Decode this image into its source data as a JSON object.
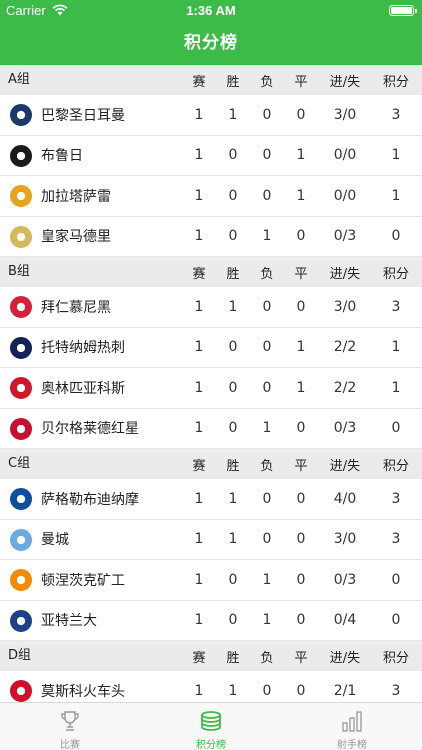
{
  "status": {
    "carrier": "Carrier",
    "time": "1:36 AM"
  },
  "header": {
    "title": "积分榜"
  },
  "columns": {
    "played": "赛",
    "won": "胜",
    "lost": "负",
    "drawn": "平",
    "goals": "进/失",
    "points": "积分"
  },
  "groups": [
    {
      "name": "A组",
      "teams": [
        {
          "name": "巴黎圣日耳曼",
          "p": "1",
          "w": "1",
          "l": "0",
          "d": "0",
          "g": "3/0",
          "pts": "3",
          "crest": "psg-crest",
          "color": "#1b3a6b"
        },
        {
          "name": "布鲁日",
          "p": "1",
          "w": "0",
          "l": "0",
          "d": "1",
          "g": "0/0",
          "pts": "1",
          "crest": "club-brugge-crest",
          "color": "#1a1a1a"
        },
        {
          "name": "加拉塔萨雷",
          "p": "1",
          "w": "0",
          "l": "0",
          "d": "1",
          "g": "0/0",
          "pts": "1",
          "crest": "galatasaray-crest",
          "color": "#e8a21b"
        },
        {
          "name": "皇家马德里",
          "p": "1",
          "w": "0",
          "l": "1",
          "d": "0",
          "g": "0/3",
          "pts": "0",
          "crest": "real-madrid-crest",
          "color": "#d4b85a"
        }
      ]
    },
    {
      "name": "B组",
      "teams": [
        {
          "name": "拜仁慕尼黑",
          "p": "1",
          "w": "1",
          "l": "0",
          "d": "0",
          "g": "3/0",
          "pts": "3",
          "crest": "bayern-crest",
          "color": "#d6203a"
        },
        {
          "name": "托特纳姆热刺",
          "p": "1",
          "w": "0",
          "l": "0",
          "d": "1",
          "g": "2/2",
          "pts": "1",
          "crest": "tottenham-crest",
          "color": "#132257"
        },
        {
          "name": "奥林匹亚科斯",
          "p": "1",
          "w": "0",
          "l": "0",
          "d": "1",
          "g": "2/2",
          "pts": "1",
          "crest": "olympiacos-crest",
          "color": "#d0182c"
        },
        {
          "name": "贝尔格莱德红星",
          "p": "1",
          "w": "0",
          "l": "1",
          "d": "0",
          "g": "0/3",
          "pts": "0",
          "crest": "red-star-crest",
          "color": "#c8102e"
        }
      ]
    },
    {
      "name": "C组",
      "teams": [
        {
          "name": "萨格勒布迪纳摩",
          "p": "1",
          "w": "1",
          "l": "0",
          "d": "0",
          "g": "4/0",
          "pts": "3",
          "crest": "dinamo-zagreb-crest",
          "color": "#0b4ea2"
        },
        {
          "name": "曼城",
          "p": "1",
          "w": "1",
          "l": "0",
          "d": "0",
          "g": "3/0",
          "pts": "3",
          "crest": "man-city-crest",
          "color": "#6cabdd"
        },
        {
          "name": "顿涅茨克矿工",
          "p": "1",
          "w": "0",
          "l": "1",
          "d": "0",
          "g": "0/3",
          "pts": "0",
          "crest": "shakhtar-crest",
          "color": "#f28c00"
        },
        {
          "name": "亚特兰大",
          "p": "1",
          "w": "0",
          "l": "1",
          "d": "0",
          "g": "0/4",
          "pts": "0",
          "crest": "atalanta-crest",
          "color": "#1e3f8a"
        }
      ]
    },
    {
      "name": "D组",
      "teams": [
        {
          "name": "莫斯科火车头",
          "p": "1",
          "w": "1",
          "l": "0",
          "d": "0",
          "g": "2/1",
          "pts": "3",
          "crest": "lokomotiv-crest",
          "color": "#d0102a"
        }
      ]
    }
  ],
  "tabs": [
    {
      "label": "比赛",
      "icon": "trophy-icon",
      "active": false
    },
    {
      "label": "积分榜",
      "icon": "coin-stack-icon",
      "active": true
    },
    {
      "label": "射手榜",
      "icon": "bar-chart-icon",
      "active": false
    }
  ],
  "colors": {
    "accent": "#3dbb49",
    "group_bg": "#ebebeb"
  }
}
